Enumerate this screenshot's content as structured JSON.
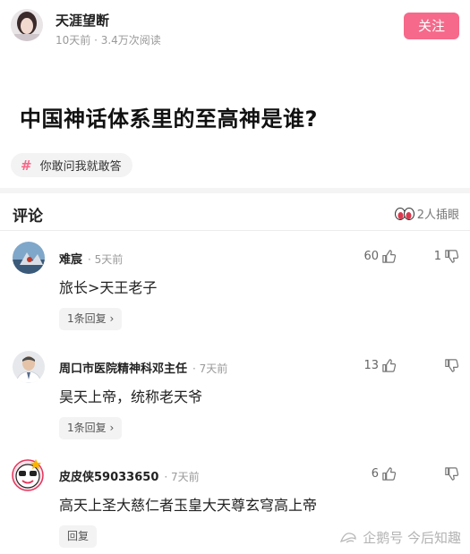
{
  "author": {
    "name": "天涯望断",
    "meta": "10天前 · 3.4万次阅读",
    "follow_label": "关注"
  },
  "question": {
    "title": "中国神话体系里的至高神是谁?"
  },
  "topic": {
    "icon": "hash-icon",
    "label": "你敢问我就敢答"
  },
  "comments_header": {
    "title": "评论",
    "insert_info": "2人插眼"
  },
  "comments": [
    {
      "user": "难宸",
      "time": "· 5天前",
      "text": "旅长>天王老子",
      "likes": "60",
      "dislikes": "1",
      "reply_label": "1条回复 ›"
    },
    {
      "user": "周口市医院精神科邓主任",
      "time": "· 7天前",
      "text": "昊天上帝，统称老天爷",
      "likes": "13",
      "dislikes": "",
      "reply_label": "1条回复 ›"
    },
    {
      "user": "皮皮侠59033650",
      "time": "· 7天前",
      "text": "高天上圣大慈仁者玉皇大天尊玄穹高上帝",
      "likes": "6",
      "dislikes": "",
      "reply_label": "回复"
    }
  ],
  "watermark": {
    "text": "企鹅号 今后知趣"
  },
  "colors": {
    "accent": "#f6698a",
    "text": "#222222",
    "muted": "#9a9a9a",
    "chip_bg": "#f3f3f3"
  }
}
